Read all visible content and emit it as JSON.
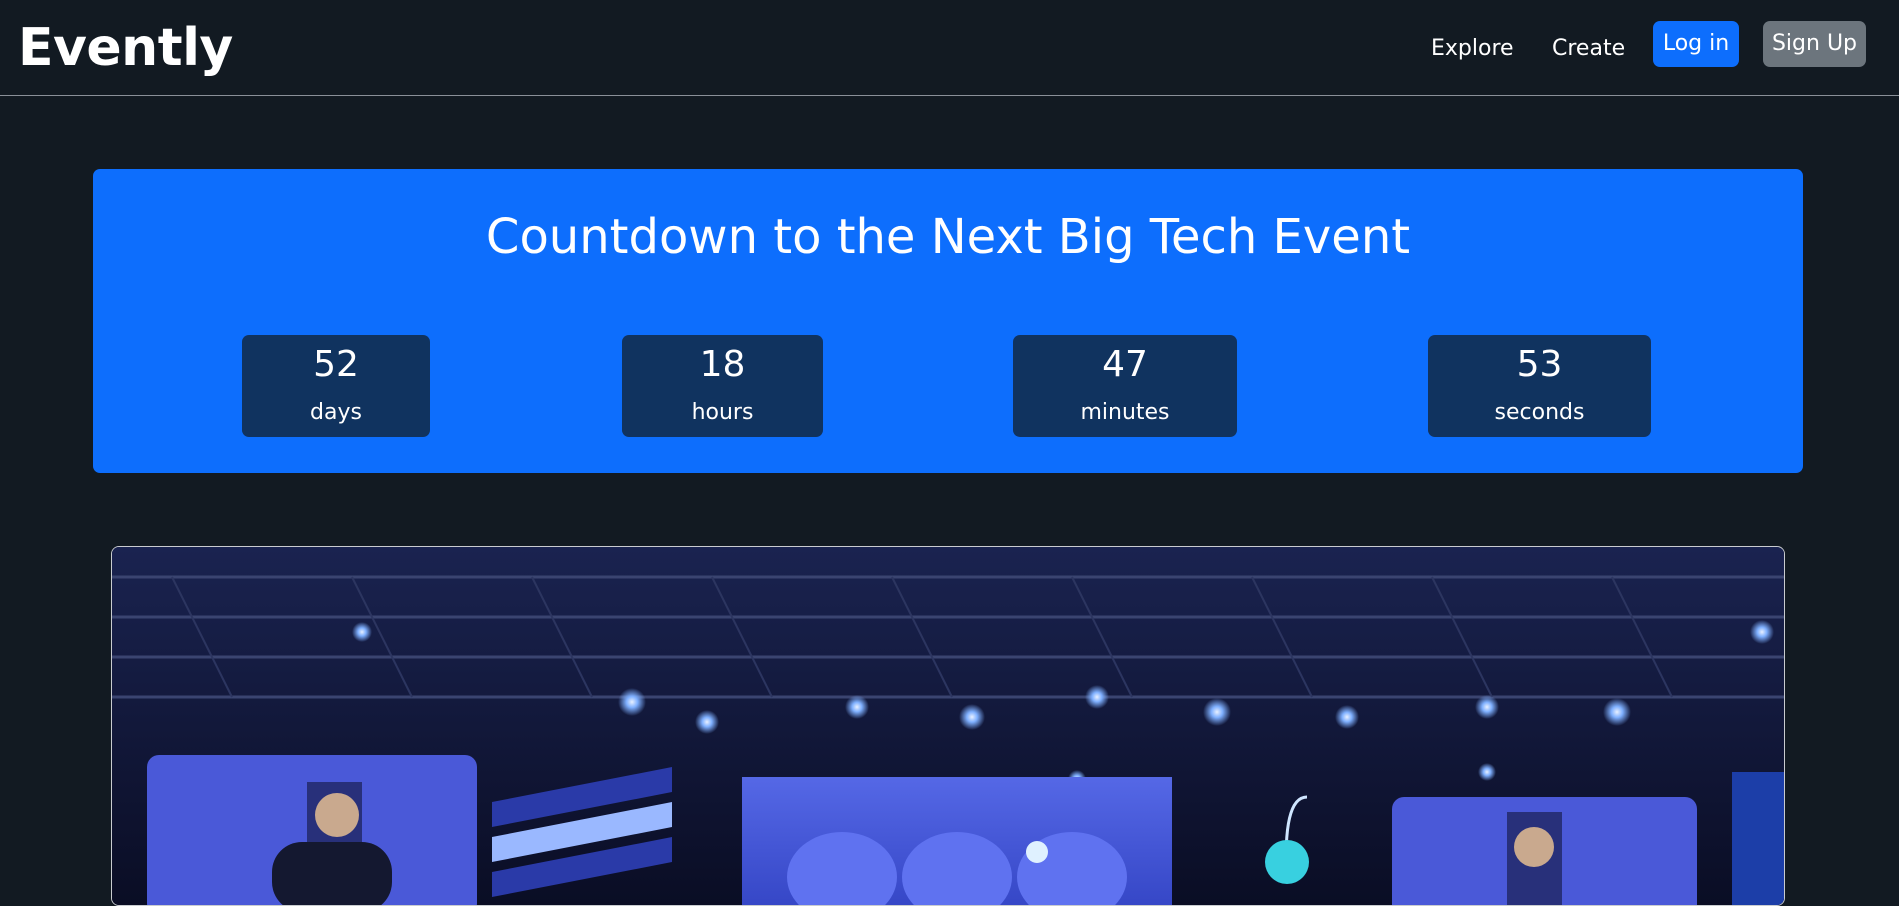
{
  "navbar": {
    "brand": "Evently",
    "links": [
      {
        "label": "Explore"
      },
      {
        "label": "Create"
      }
    ],
    "login_label": "Log in",
    "signup_label": "Sign Up",
    "colors": {
      "background": "#121a22",
      "login_button": "#0d6efd",
      "signup_button": "#6c757d"
    }
  },
  "countdown": {
    "title": "Countdown to the Next Big Tech Event",
    "background": "#0d6efd",
    "box_color": "#10335f",
    "units": [
      {
        "value": "52",
        "label": "days"
      },
      {
        "value": "18",
        "label": "hours"
      },
      {
        "value": "47",
        "label": "minutes"
      },
      {
        "value": "53",
        "label": "seconds"
      }
    ]
  },
  "hero_image": {
    "icon": "stage-photo",
    "colors": {
      "ceiling": "#141a3a",
      "stage": "#3b4fd8",
      "light": "#6fa9ff"
    }
  }
}
